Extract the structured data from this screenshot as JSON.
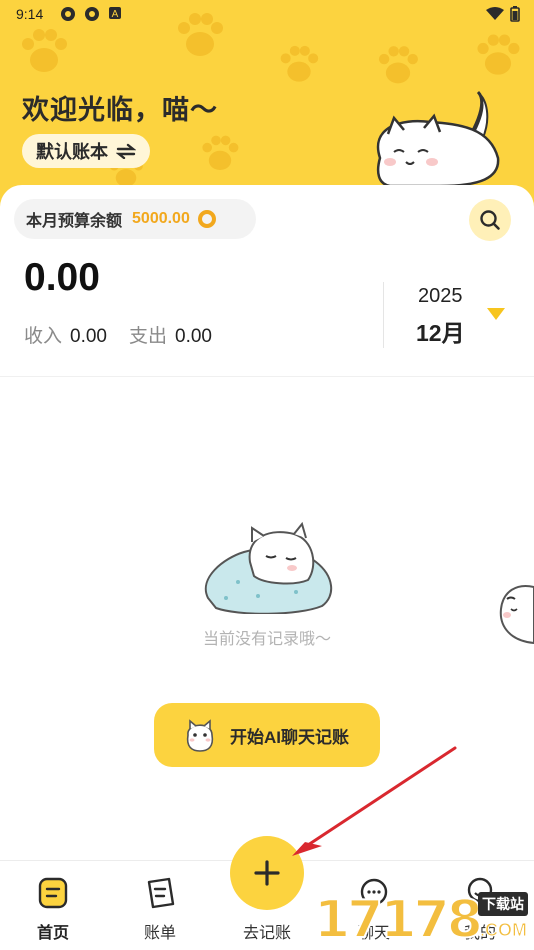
{
  "status_bar": {
    "time": "9:14"
  },
  "header": {
    "welcome": "欢迎光临，喵～",
    "account_book": "默认账本"
  },
  "summary": {
    "budget_label": "本月预算余额",
    "budget_amount": "5000.00",
    "balance": "0.00",
    "income_label": "收入",
    "income_value": "0.00",
    "expense_label": "支出",
    "expense_value": "0.00",
    "year": "2025",
    "month": "12月"
  },
  "empty_state": {
    "message": "当前没有记录哦～",
    "ai_button": "开始AI聊天记账"
  },
  "tabbar": {
    "home": "首页",
    "bills": "账单",
    "add": "去记账",
    "chat": "聊天",
    "mine": "我的"
  },
  "watermark": {
    "numbers": "17178",
    "tag": "下载站",
    "suffix": ".COM"
  },
  "colors": {
    "accent": "#FCD33F",
    "budget": "#F2A81D",
    "arrow": "#D9282F"
  }
}
